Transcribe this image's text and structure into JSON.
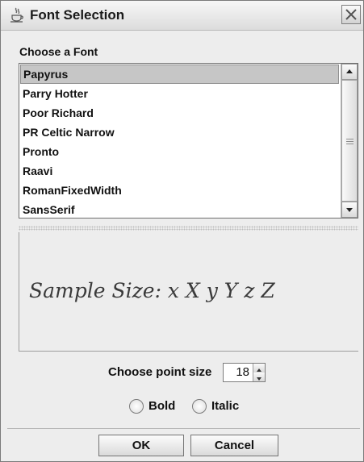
{
  "window": {
    "title": "Font Selection",
    "icon": "java-cup-icon"
  },
  "font_chooser": {
    "label": "Choose a Font",
    "fonts": [
      "Papyrus",
      "Parry Hotter",
      "Poor Richard",
      "PR Celtic Narrow",
      "Pronto",
      "Raavi",
      "RomanFixedWidth",
      "SansSerif"
    ],
    "selected_index": 0
  },
  "preview": {
    "sample_text": "Sample Size: x X y Y z Z"
  },
  "point_size": {
    "label": "Choose point size",
    "value": "18"
  },
  "style_options": {
    "bold_label": "Bold",
    "bold_checked": false,
    "italic_label": "Italic",
    "italic_checked": false
  },
  "buttons": {
    "ok_label": "OK",
    "cancel_label": "Cancel"
  }
}
